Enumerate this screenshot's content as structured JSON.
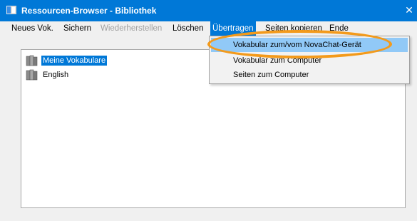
{
  "window": {
    "title": "Ressourcen-Browser - Bibliothek",
    "close_glyph": "✕",
    "titlebar_color": "#0078d7"
  },
  "menubar": {
    "items": [
      {
        "label": "Neues Vok.",
        "state": "normal"
      },
      {
        "label": "Sichern",
        "state": "normal"
      },
      {
        "label": "Wiederherstellen",
        "state": "disabled"
      },
      {
        "label": "Löschen",
        "state": "normal"
      },
      {
        "label": "Übertragen",
        "state": "active"
      },
      {
        "label": "Seiten kopieren",
        "state": "normal"
      },
      {
        "label": "Ende",
        "state": "normal"
      }
    ]
  },
  "dropdown": {
    "items": [
      {
        "label": "Vokabular zum/vom NovaChat-Gerät",
        "hover": true
      },
      {
        "label": "Vokabular zum Computer",
        "hover": false
      },
      {
        "label": "Seiten zum Computer",
        "hover": false
      }
    ]
  },
  "tree": {
    "items": [
      {
        "label": "Meine Vokabulare",
        "selected": true,
        "icon": "library-icon"
      },
      {
        "label": "English",
        "selected": false,
        "icon": "library-icon"
      }
    ]
  },
  "annotation": {
    "color": "#f39a1b",
    "shape": "ellipse"
  }
}
